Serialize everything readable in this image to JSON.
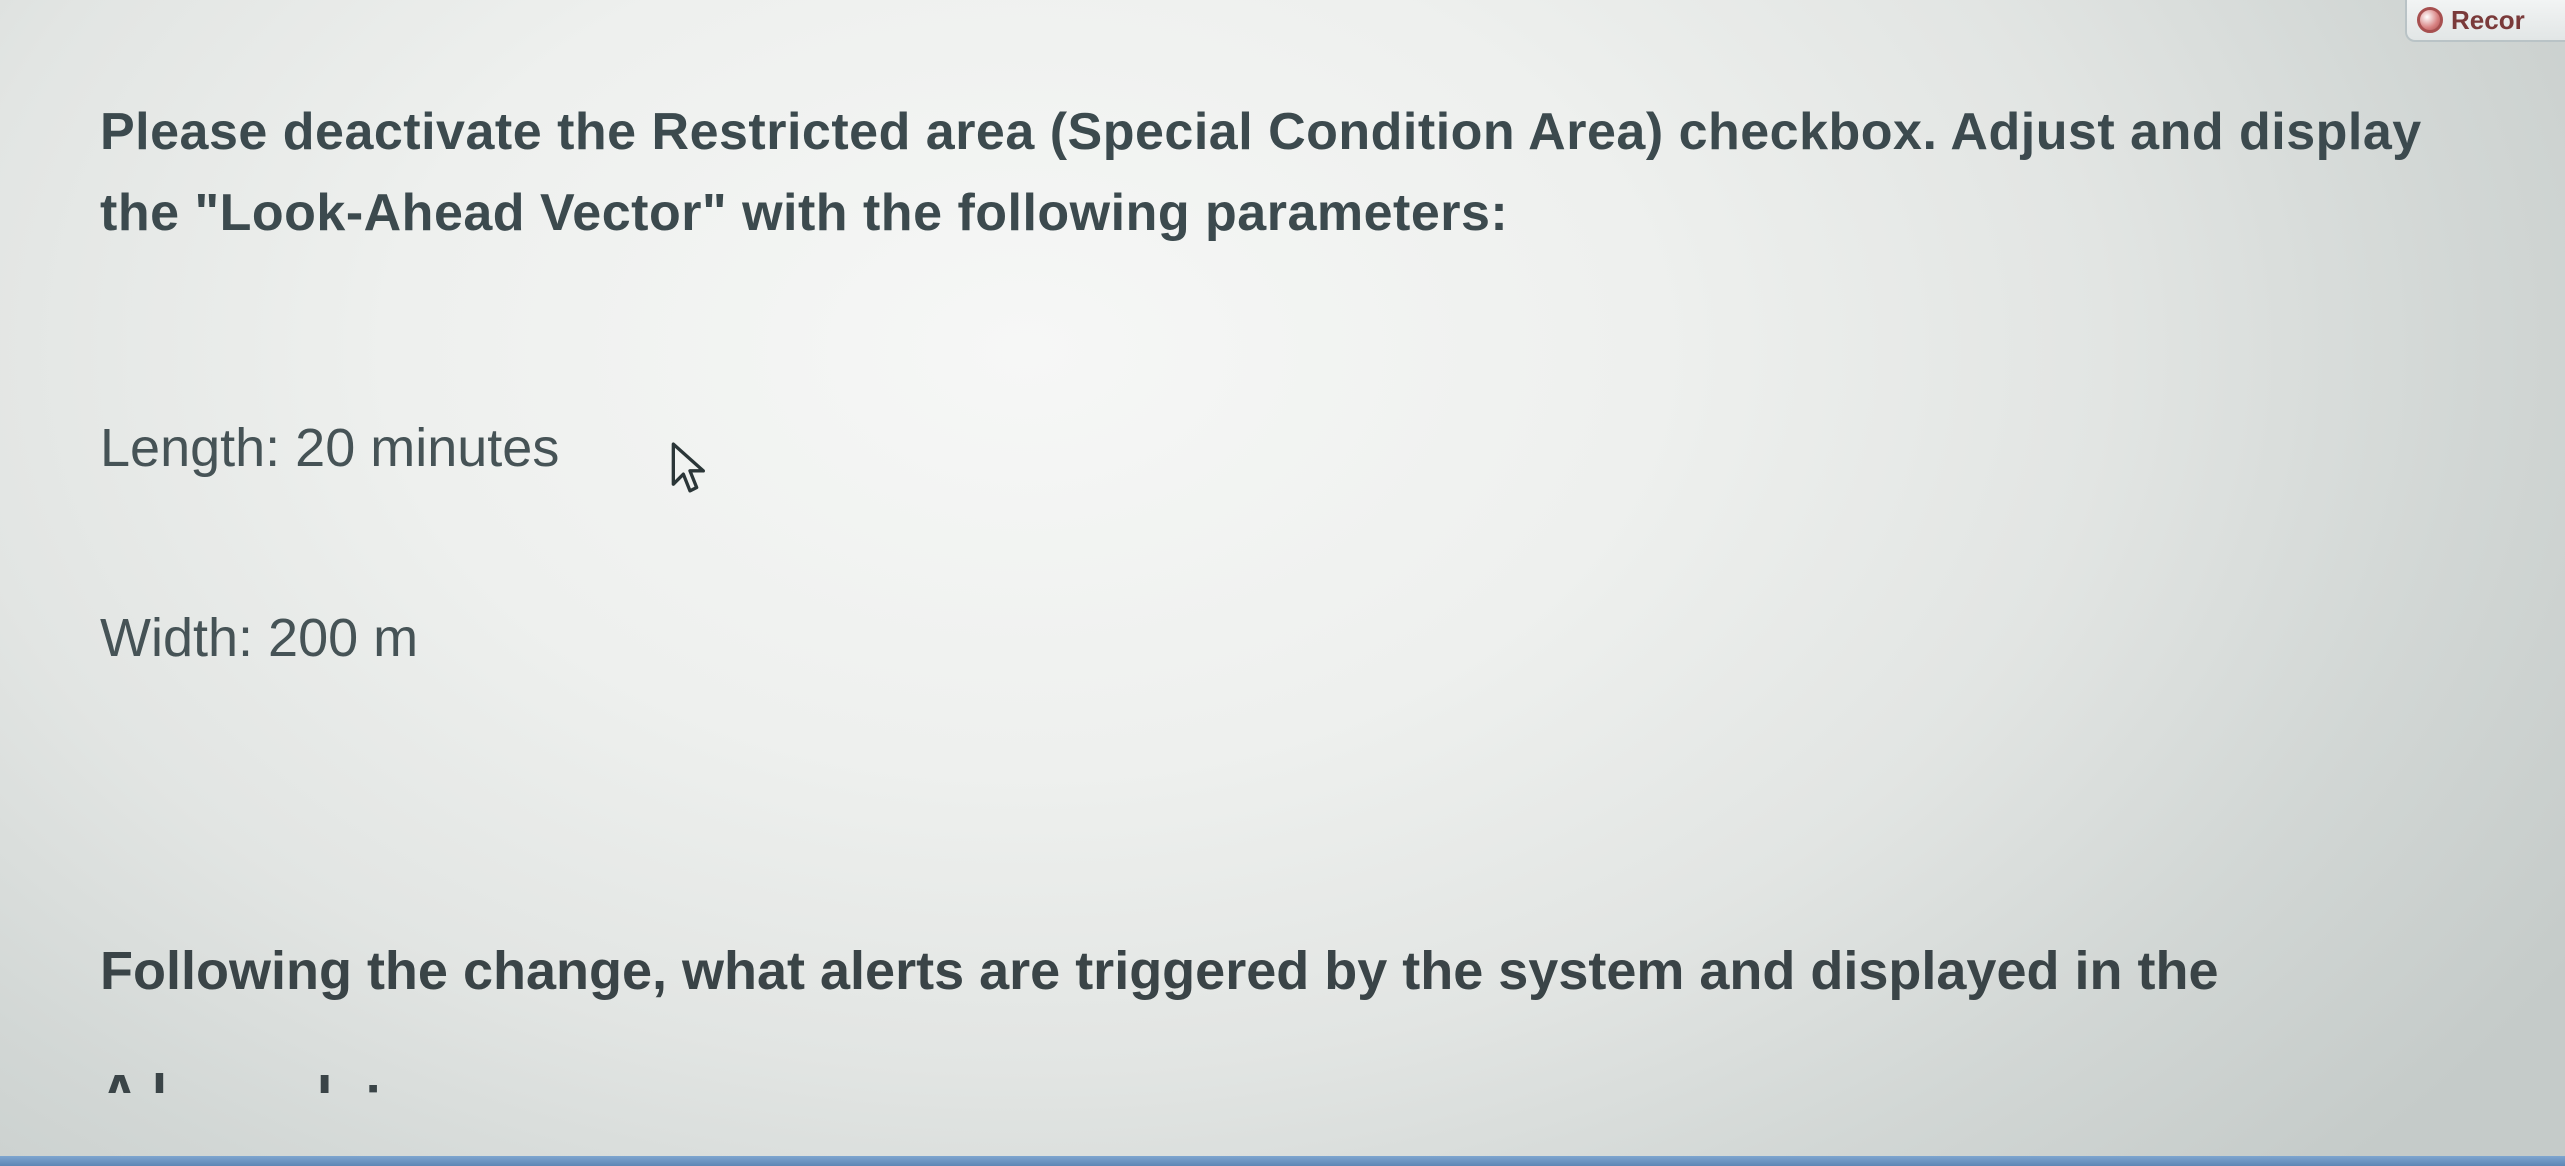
{
  "record_button": {
    "label": "Recor"
  },
  "instruction": {
    "text": "Please deactivate the Restricted area (Special Condition Area) checkbox. Adjust and display the \"Look-Ahead Vector\" with the following parameters:"
  },
  "parameters": {
    "length": "Length: 20 minutes",
    "width": "Width: 200 m"
  },
  "followup": {
    "text": "Following the change, what alerts are triggered by the system and displayed in the"
  },
  "partial_next_line": "A l _ _ _ L : _ _ _ "
}
